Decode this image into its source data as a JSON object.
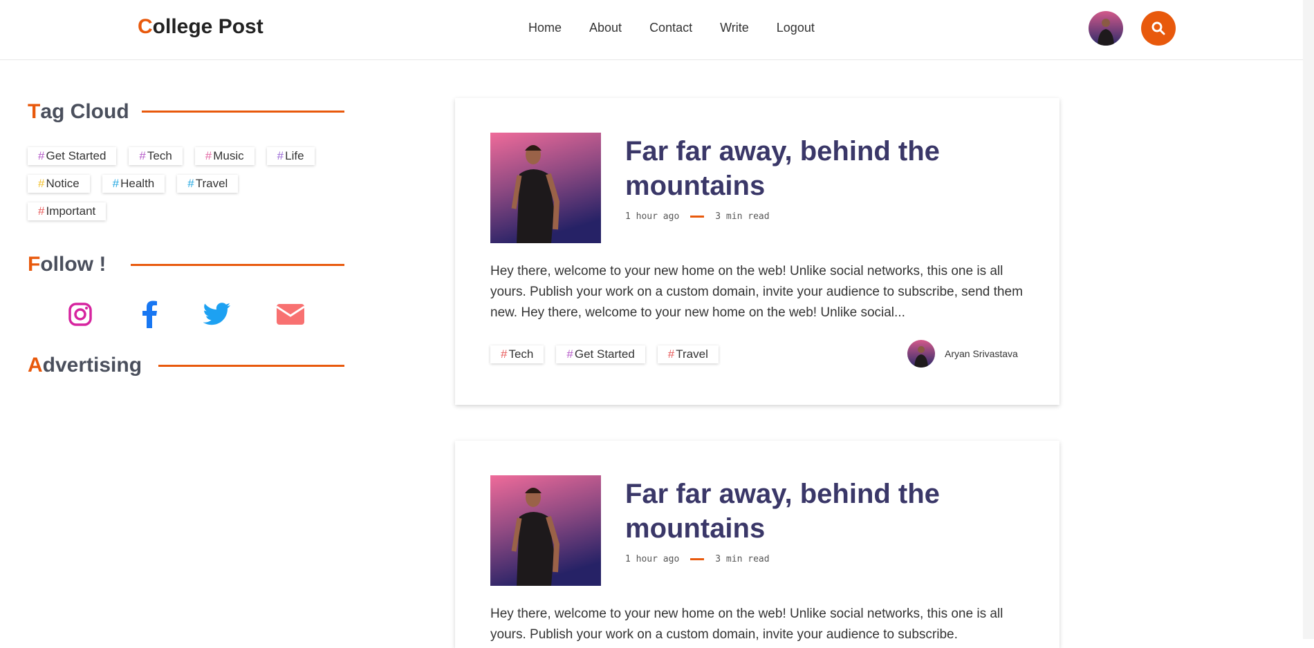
{
  "header": {
    "logo_first": "C",
    "logo_rest": "ollege Post",
    "nav": [
      {
        "label": "Home",
        "name": "nav-home"
      },
      {
        "label": "About",
        "name": "nav-about"
      },
      {
        "label": "Contact",
        "name": "nav-contact"
      },
      {
        "label": "Write",
        "name": "nav-write"
      },
      {
        "label": "Logout",
        "name": "nav-logout"
      }
    ],
    "search_icon": "search-icon",
    "accent": "#e8590c"
  },
  "sidebar": {
    "tag_cloud": {
      "first": "T",
      "rest": "ag Cloud"
    },
    "tags": [
      {
        "label": "Get Started",
        "hash": "#",
        "color": "#b65cc9"
      },
      {
        "label": "Tech",
        "hash": "#",
        "color": "#b65cc9"
      },
      {
        "label": "Music",
        "hash": "#",
        "color": "#e46aa5"
      },
      {
        "label": "Life",
        "hash": "#",
        "color": "#9b6ad6"
      },
      {
        "label": "Notice",
        "hash": "#",
        "color": "#f2c12e"
      },
      {
        "label": "Health",
        "hash": "#",
        "color": "#27a9e1"
      },
      {
        "label": "Travel",
        "hash": "#",
        "color": "#27a9e1"
      },
      {
        "label": "Important",
        "hash": "#",
        "color": "#e85c5c"
      }
    ],
    "follow": {
      "first": "F",
      "rest": "ollow !"
    },
    "social": [
      "instagram-icon",
      "facebook-icon",
      "twitter-icon",
      "email-icon"
    ],
    "advertising": {
      "first": "A",
      "rest": "dvertising"
    }
  },
  "posts": [
    {
      "title": "Far far away, behind the mountains",
      "time": "1 hour ago",
      "read": "3 min read",
      "excerpt": "Hey there, welcome to your new home on the web! Unlike social networks, this one is all yours. Publish your work on a custom domain, invite your audience to subscribe, send them new. Hey there, welcome to your new home on the web! Unlike social...",
      "tags": [
        {
          "label": "Tech",
          "hash": "#",
          "color": "#e85c5c"
        },
        {
          "label": "Get Started",
          "hash": "#",
          "color": "#b65cc9"
        },
        {
          "label": "Travel",
          "hash": "#",
          "color": "#e85c5c"
        }
      ],
      "author": "Aryan Srivastava"
    },
    {
      "title": "Far far away, behind the mountains",
      "time": "1 hour ago",
      "read": "3 min read",
      "excerpt": "Hey there, welcome to your new home on the web! Unlike social networks, this one is all yours. Publish your work on a custom domain, invite your audience to subscribe."
    }
  ]
}
